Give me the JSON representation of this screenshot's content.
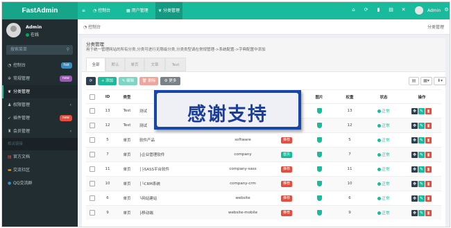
{
  "app": {
    "logo": "FastAdmin"
  },
  "topnav": {
    "items": [
      {
        "icon": "menu-icon",
        "label": "≡"
      },
      {
        "icon": "dashboard-icon",
        "label": "控制台"
      },
      {
        "icon": "user-icon",
        "label": "用户管理"
      },
      {
        "icon": "leaf-icon",
        "label": "分类管理"
      }
    ],
    "user": "Admin"
  },
  "sidebar": {
    "user": {
      "name": "Admin",
      "status": "在线"
    },
    "search_placeholder": "搜索菜单",
    "items": [
      {
        "label": "控制台",
        "badge": "hot",
        "badge_color": "#3c8dbc"
      },
      {
        "label": "常规管理",
        "badge": "new",
        "badge_color": "#9b59b6"
      },
      {
        "label": "分类管理",
        "active": true
      },
      {
        "label": "权限管理"
      },
      {
        "label": "插件管理",
        "badge": "new",
        "badge_color": "#e74c3c"
      },
      {
        "label": "会员管理"
      }
    ],
    "links_header": "相关链接",
    "links": [
      {
        "label": "官方文档",
        "color": "#e74c3c"
      },
      {
        "label": "交流社区",
        "color": "#f39c12"
      },
      {
        "label": "QQ交流群",
        "color": "#3c8dbc"
      }
    ]
  },
  "breadcrumb": {
    "home": "控制台",
    "title": "分类管理"
  },
  "panel": {
    "heading": "分类管理",
    "description": "用于统一管理网站的所有分类,分类可进行无限级分类,分类类型请在常规管理->系统配置->字典配置中添加",
    "tabs": [
      "全部",
      "默认",
      "单页",
      "文章",
      "Test"
    ]
  },
  "toolbar": {
    "refresh": "⟳",
    "add": "+ 添加",
    "edit": "✎ 编辑",
    "delete": "🗑 删除",
    "more": "⚙ 更多"
  },
  "table": {
    "columns": [
      "",
      "ID",
      "类型",
      "名称",
      "",
      "",
      "图片",
      "权重",
      "状态",
      "操作"
    ],
    "rows": [
      {
        "id": "13",
        "type": "Test",
        "name": "测试",
        "nickname": "",
        "flag": "",
        "flag_color": "",
        "weigh": "13",
        "status": "正常"
      },
      {
        "id": "12",
        "type": "Test",
        "name": "测试",
        "nickname": "",
        "flag": "",
        "flag_color": "",
        "weigh": "12",
        "status": "正常"
      },
      {
        "id": "5",
        "type": "单页",
        "name": "软件产品",
        "nickname": "software",
        "flag": "推荐",
        "flag_color": "#e74c3c",
        "weigh": "5",
        "status": "正常"
      },
      {
        "id": "7",
        "type": "单页",
        "name": "├企业管理软件",
        "nickname": "company",
        "flag": "首页",
        "flag_color": "#18bc9c",
        "weigh": "7",
        "status": "正常"
      },
      {
        "id": "11",
        "type": "单页",
        "name": "│├SASS平台软件",
        "nickname": "company-sass",
        "flag": "推荐",
        "flag_color": "#e74c3c",
        "weigh": "11",
        "status": "正常"
      },
      {
        "id": "10",
        "type": "单页",
        "name": "│└CRM系统",
        "nickname": "company-crm",
        "flag": "推荐",
        "flag_color": "#e74c3c",
        "weigh": "10",
        "status": "正常"
      },
      {
        "id": "6",
        "type": "单页",
        "name": "└网站建站",
        "nickname": "website",
        "flag": "推荐",
        "flag_color": "#e74c3c",
        "weigh": "6",
        "status": "正常"
      },
      {
        "id": "9",
        "type": "单页",
        "name": "├移动端",
        "nickname": "website-mobile",
        "flag": "推荐",
        "flag_color": "#e74c3c",
        "weigh": "9",
        "status": "正常"
      }
    ]
  },
  "overlay": {
    "text": "感谢支持"
  },
  "colors": {
    "primary": "#18bc9c",
    "sidebar": "#222d32",
    "danger": "#e74c3c",
    "dark": "#2c3e50",
    "overlay_border": "#1747a6"
  }
}
